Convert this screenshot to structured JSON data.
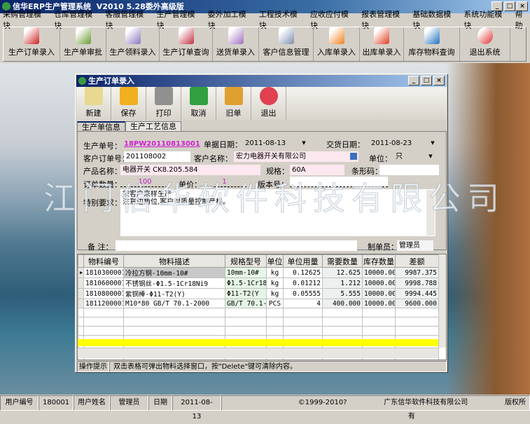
{
  "app": {
    "title": "信华ERP生产管理系统  V2010 5.28委外高级版"
  },
  "menu": [
    "采购管理模块",
    "仓库管理模块",
    "客服管理模块",
    "生产管理模块",
    "委外加工模块",
    "工程技术模块",
    "应收应付模块",
    "报表管理模块",
    "基础数据模块",
    "系统功能模块",
    "帮助"
  ],
  "toolbar": [
    {
      "label": "生产订单录入",
      "icon": "pdf-icon",
      "color": "#d02020"
    },
    {
      "label": "生产单审批",
      "icon": "plant-icon",
      "color": "#6a9a30"
    },
    {
      "label": "生产领料录入",
      "icon": "feather-icon",
      "color": "#8a78c0"
    },
    {
      "label": "生产订单查询",
      "icon": "bird-icon",
      "color": "#c03040"
    },
    {
      "label": "送货单录入",
      "icon": "feather-icon",
      "color": "#a070c0"
    },
    {
      "label": "客户信息管理",
      "icon": "feather-icon",
      "color": "#8090b0"
    },
    {
      "label": "入库单录入",
      "icon": "flower-icon",
      "color": "#f08020"
    },
    {
      "label": "出库单录入",
      "icon": "feather-icon",
      "color": "#e04020"
    },
    {
      "label": "库存物料查询",
      "icon": "quill-icon",
      "color": "#2070c0"
    },
    {
      "label": "退出系统",
      "icon": "power-icon",
      "color": "#e03030"
    }
  ],
  "watermark": "江门信华软件科技有限公司",
  "child": {
    "title": "生产订单录入",
    "toolbar": [
      {
        "label": "新建",
        "icon": "clipboard-icon",
        "color": "#e8d890"
      },
      {
        "label": "保存",
        "icon": "save-icon",
        "color": "#f0b020"
      },
      {
        "label": "打印",
        "icon": "printer-icon",
        "color": "#909090"
      },
      {
        "label": "取消",
        "icon": "undo-icon",
        "color": "#30a040"
      },
      {
        "label": "旧单",
        "icon": "folder-icon",
        "color": "#e0a030"
      },
      {
        "label": "退出",
        "icon": "power-icon",
        "color": "#e04050"
      }
    ],
    "tabs": [
      "生产单信息",
      "生产工艺信息"
    ],
    "form": {
      "order_no_label": "生产单号：",
      "order_no": "18PW20110813001",
      "doc_date_label": "单据日期：",
      "doc_date": "2011-08-13",
      "delivery_date_label": "交货日期：",
      "delivery_date": "2011-08-23",
      "cust_order_label": "客户订单号：",
      "cust_order": "201108002",
      "cust_name_label": "客户名称：",
      "cust_name": "宏力电器开关有限公司",
      "unit_label": "单位：",
      "unit": "只",
      "product_label": "产品名称：",
      "product": "电器开关 CK8.205.584",
      "spec_label": "规格：",
      "spec": "60A",
      "barcode_label": "条形码：",
      "barcode": "",
      "qty_label": "订单数量：",
      "qty": "100",
      "price_label": "单价：",
      "price": "1",
      "version_label": "版本号：",
      "version": "",
      "special_label": "特别要求：",
      "special": "按客户来样生产\n注意边角位,客户对质量控制严格。",
      "remark_label": "备 注：",
      "remark": "",
      "maker_label": "制单员：",
      "maker": "管理员"
    },
    "grid": {
      "headers": [
        "物料编号",
        "物料描述",
        "规格型号",
        "单位",
        "单位用量",
        "需要数量",
        "库存数量",
        "差额"
      ],
      "rows": [
        [
          "1810300001",
          "冷拉方钢-10mm-10#",
          "10mm-10#",
          "kg",
          "0.12625",
          "12.625",
          "10000.000",
          "9987.375"
        ],
        [
          "1810600001",
          "不锈钢丝-Φ1.5-1Cr18Ni9",
          "Φ1.5-1Cr18",
          "kg",
          "0.01212",
          "1.212",
          "10000.000",
          "9998.788"
        ],
        [
          "1810800001",
          "紫铜棒-Φ11-T2(Y)",
          "Φ11-T2(Y",
          "kg",
          "0.05555",
          "5.555",
          "10000.000",
          "9994.445"
        ],
        [
          "1811200001",
          "M10*80 GB/T 70.1-2000",
          "GB/T 70.1-2",
          "PCS",
          "4",
          "400.000",
          "10000.000",
          "9600.000"
        ]
      ]
    },
    "hint_label": "操作提示",
    "hint": "双击表格可弹出物料选择窗口，按\"Delete\"键可清除内容。"
  },
  "status": {
    "user_no_label": "用户编号",
    "user_no": "180001",
    "user_name_label": "用户姓名",
    "user_name": "管理员",
    "date_label": "日期",
    "date": "2011-08-13",
    "copyright": "©1999-2010?",
    "company": "广东信华软件科技有限公司",
    "rights": "版权所有"
  }
}
